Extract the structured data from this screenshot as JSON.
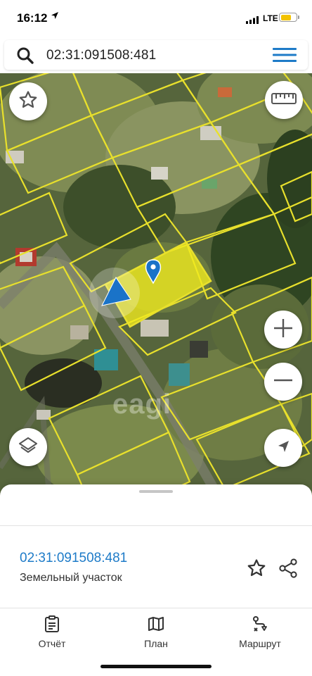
{
  "status_bar": {
    "time": "16:12",
    "network": "LTE",
    "battery_level": 0.7,
    "icons": [
      "location-arrow-icon",
      "signal-icon",
      "battery-icon"
    ]
  },
  "search": {
    "value": "02:31:091508:481",
    "icons": [
      "search-icon",
      "menu-icon"
    ]
  },
  "map": {
    "watermark": "eagi",
    "parcel_outline_color": "#e8e02c",
    "selected_parcel_fill": "#f2ec1e",
    "user_location_color": "#1a73c8",
    "marker_color": "#1a73c8",
    "controls": [
      "favorite-star-icon",
      "ruler-icon",
      "zoom-in-icon",
      "zoom-out-icon",
      "layers-icon",
      "navigate-arrow-icon"
    ]
  },
  "sheet": {
    "parcel_id": "02:31:091508:481",
    "parcel_type": "Земельный участок",
    "accent_color": "#1e7bc8"
  },
  "tabs": [
    {
      "label": "Отчёт",
      "icon": "clipboard-icon"
    },
    {
      "label": "План",
      "icon": "map-book-icon"
    },
    {
      "label": "Маршрут",
      "icon": "route-icon"
    }
  ]
}
